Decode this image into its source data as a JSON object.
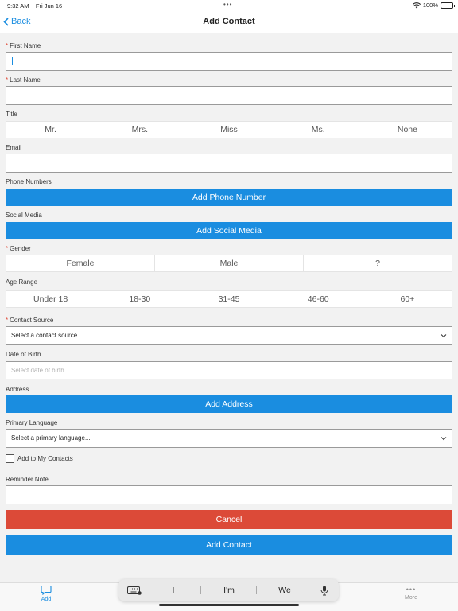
{
  "status": {
    "time": "9:32 AM",
    "date": "Fri Jun 16",
    "battery": "100%",
    "wifi_icon": "wifi-icon",
    "battery_icon": "battery-icon"
  },
  "nav": {
    "back_label": "Back",
    "title": "Add Contact"
  },
  "form": {
    "first_name": {
      "label": "First Name",
      "value": ""
    },
    "last_name": {
      "label": "Last Name",
      "value": ""
    },
    "title": {
      "label": "Title",
      "options": [
        "Mr.",
        "Mrs.",
        "Miss",
        "Ms.",
        "None"
      ]
    },
    "email": {
      "label": "Email",
      "value": ""
    },
    "phone": {
      "label": "Phone Numbers",
      "button": "Add Phone Number"
    },
    "social": {
      "label": "Social Media",
      "button": "Add Social Media"
    },
    "gender": {
      "label": "Gender",
      "options": [
        "Female",
        "Male",
        "?"
      ]
    },
    "age": {
      "label": "Age Range",
      "options": [
        "Under 18",
        "18-30",
        "31-45",
        "46-60",
        "60+"
      ]
    },
    "contact_source": {
      "label": "Contact Source",
      "value": "Select a contact source..."
    },
    "dob": {
      "label": "Date of Birth",
      "placeholder": "Select date of birth..."
    },
    "address": {
      "label": "Address",
      "button": "Add Address"
    },
    "language": {
      "label": "Primary Language",
      "value": "Select a primary language..."
    },
    "my_contacts": {
      "label": "Add to My Contacts",
      "checked": false
    },
    "reminder": {
      "label": "Reminder Note",
      "value": ""
    },
    "cancel": "Cancel",
    "submit": "Add Contact"
  },
  "tabs": [
    {
      "label": "Add",
      "icon": "chat-bubble-icon",
      "active": true
    },
    {
      "label": "More",
      "icon": "more-dots-icon",
      "active": false
    }
  ],
  "keyboard": {
    "suggestions": [
      "I",
      "I'm",
      "We"
    ]
  },
  "colors": {
    "accent": "#1a8de0",
    "danger": "#dc4a38",
    "background": "#f2f2f2"
  }
}
